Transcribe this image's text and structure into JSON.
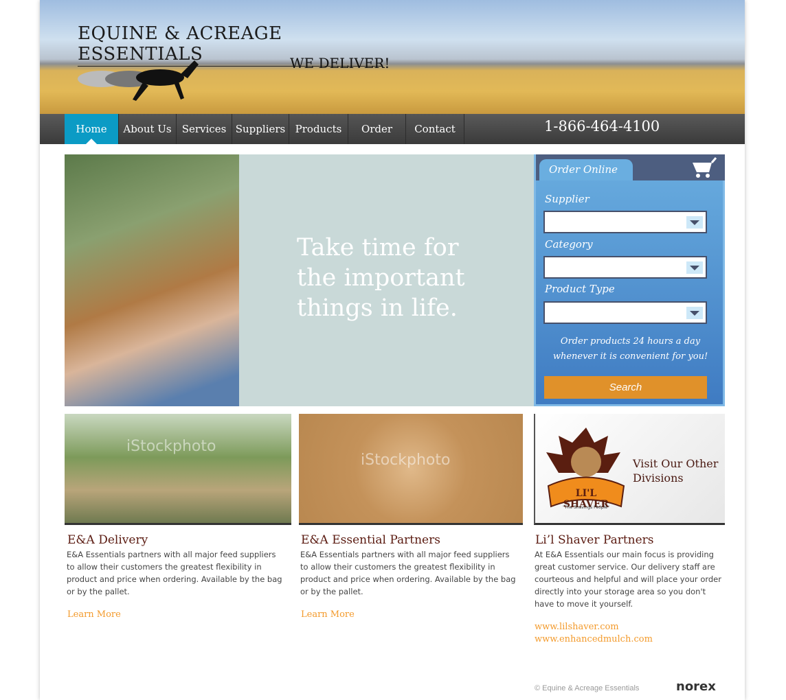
{
  "header": {
    "brand": "EQUINE & ACREAGE ESSENTIALS",
    "tagline": "WE DELIVER!"
  },
  "nav": {
    "items": [
      {
        "label": "Home"
      },
      {
        "label": "About Us"
      },
      {
        "label": "Services"
      },
      {
        "label": "Suppliers"
      },
      {
        "label": "Products"
      },
      {
        "label": "Order"
      },
      {
        "label": "Contact"
      }
    ],
    "phone": "1-866-464-4100"
  },
  "hero": {
    "text": "Take time for the important things in life."
  },
  "order": {
    "title": "Order Online",
    "supplier_label": "Supplier",
    "category_label": "Category",
    "product_type_label": "Product Type",
    "note": "Order products 24 hours a day whenever it is convenient for you!",
    "search_label": "Search"
  },
  "cards": [
    {
      "title": "E&A Delivery",
      "body": "E&A Essentials partners with all major feed suppliers to allow their customers the greatest flexibility in product and price when ordering. Available by the bag or by the pallet.",
      "link": "Learn More",
      "watermark": "iStockphoto"
    },
    {
      "title": "E&A Essential Partners",
      "body": "E&A Essentials partners with all major feed suppliers to allow their customers the greatest flexibility in product and price when ordering. Available by the bag or by the pallet.",
      "link": "Learn More",
      "watermark": "iStockphoto"
    },
    {
      "title": "Li’l Shaver Partners",
      "body": "At E&A Essentials our main focus is providing great customer service. Our delivery staff are courteous and helpful and will place your order directly into your storage area so you don't have to move it yourself.",
      "links": [
        "www.lilshaver.com",
        "www.enhancedmulch.com"
      ],
      "promo": "Visit Our Other Divisions",
      "logo_text": "LI'L SHAVER",
      "logo_tagline": "\"The Shavings People\""
    }
  ],
  "footer": {
    "copyright": "© Equine & Acreage Essentials",
    "credit": "norex"
  }
}
